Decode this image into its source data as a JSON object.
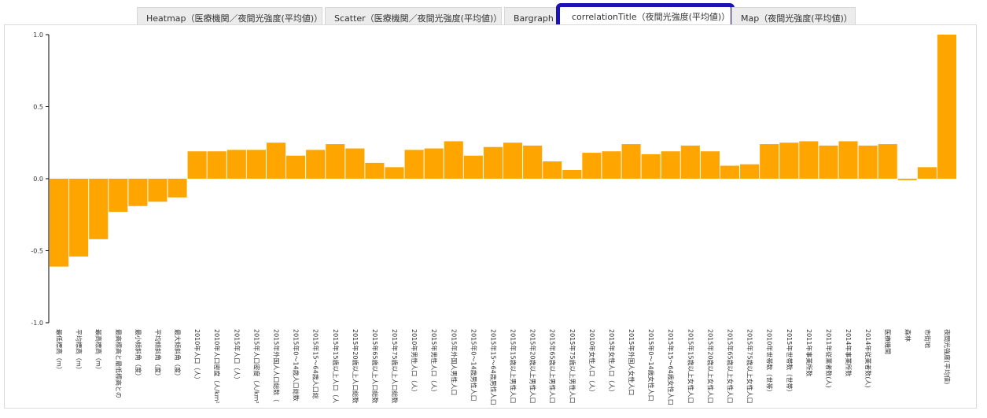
{
  "tabs": [
    {
      "label": "Heatmap（医療機関／夜間光強度(平均値)）"
    },
    {
      "label": "Scatter（医療機関／夜間光強度(平均値)）"
    },
    {
      "label": "Bargraph"
    },
    {
      "label": "correlationTitle（夜間光強度(平均値)）"
    },
    {
      "label": "Map（夜間光強度(平均値)）"
    }
  ],
  "active_tab_index": 3,
  "colors": {
    "bar": "#ffa500",
    "axis": "#000000",
    "active_tab_border": "#1a12b3"
  },
  "chart_data": {
    "type": "bar",
    "ylim": [
      -1.0,
      1.0
    ],
    "yticks": [
      "-1.0",
      "-0.5",
      "0.0",
      "0.5",
      "1.0"
    ],
    "ytick_values": [
      -1.0,
      -0.5,
      0.0,
      0.5,
      1.0
    ],
    "categories": [
      "最低標高（m）",
      "平均標高（m）",
      "最高標高（m）",
      "最高標高と最低標高との",
      "最小傾斜角（度）",
      "平均傾斜角（度）",
      "最大傾斜角（度）",
      "2010年人口（人）",
      "2010年人口密度（人/km²",
      "2015年人口（人）",
      "2015年人口密度（人/km²",
      "2015年外国人人口総数（",
      "2015年0～14歳人口総数",
      "2015年15～64歳人口総",
      "2015年15歳以上人口（人",
      "2015年20歳以上人口総数",
      "2015年65歳以上人口総数",
      "2015年75歳以上人口総数",
      "2010年男性人口（人）",
      "2015年男性人口（人）",
      "2015年外国人男性人口",
      "2015年0～14歳男性人口",
      "2015年15～64歳男性人口",
      "2015年15歳以上男性人口",
      "2015年20歳以上男性人口",
      "2015年65歳以上男性人口",
      "2015年75歳以上男性人口",
      "2010年女性人口（人）",
      "2015年女性人口（人）",
      "2015年外国人女性人口",
      "2015年0～14歳女性人口",
      "2015年15～64歳女性人口",
      "2015年15歳以上女性人口",
      "2015年20歳以上女性人口",
      "2015年65歳以上女性人口",
      "2015年75歳以上女性人口",
      "2010年世帯数（世帯）",
      "2015年世帯数（世帯）",
      "2011年事業所数",
      "2011年従業者数(人)",
      "2014年事業所数",
      "2014年従業者数(人)",
      "医療機関",
      "森林",
      "市街地",
      "夜間光強度(平均値)"
    ],
    "values": [
      -0.61,
      -0.54,
      -0.42,
      -0.23,
      -0.19,
      -0.16,
      -0.13,
      0.19,
      0.19,
      0.2,
      0.2,
      0.25,
      0.16,
      0.2,
      0.24,
      0.21,
      0.11,
      0.08,
      0.2,
      0.21,
      0.26,
      0.16,
      0.22,
      0.25,
      0.23,
      0.12,
      0.06,
      0.18,
      0.19,
      0.24,
      0.17,
      0.19,
      0.23,
      0.19,
      0.09,
      0.1,
      0.24,
      0.25,
      0.26,
      0.23,
      0.26,
      0.23,
      0.24,
      -0.01,
      0.08,
      1.0
    ]
  }
}
